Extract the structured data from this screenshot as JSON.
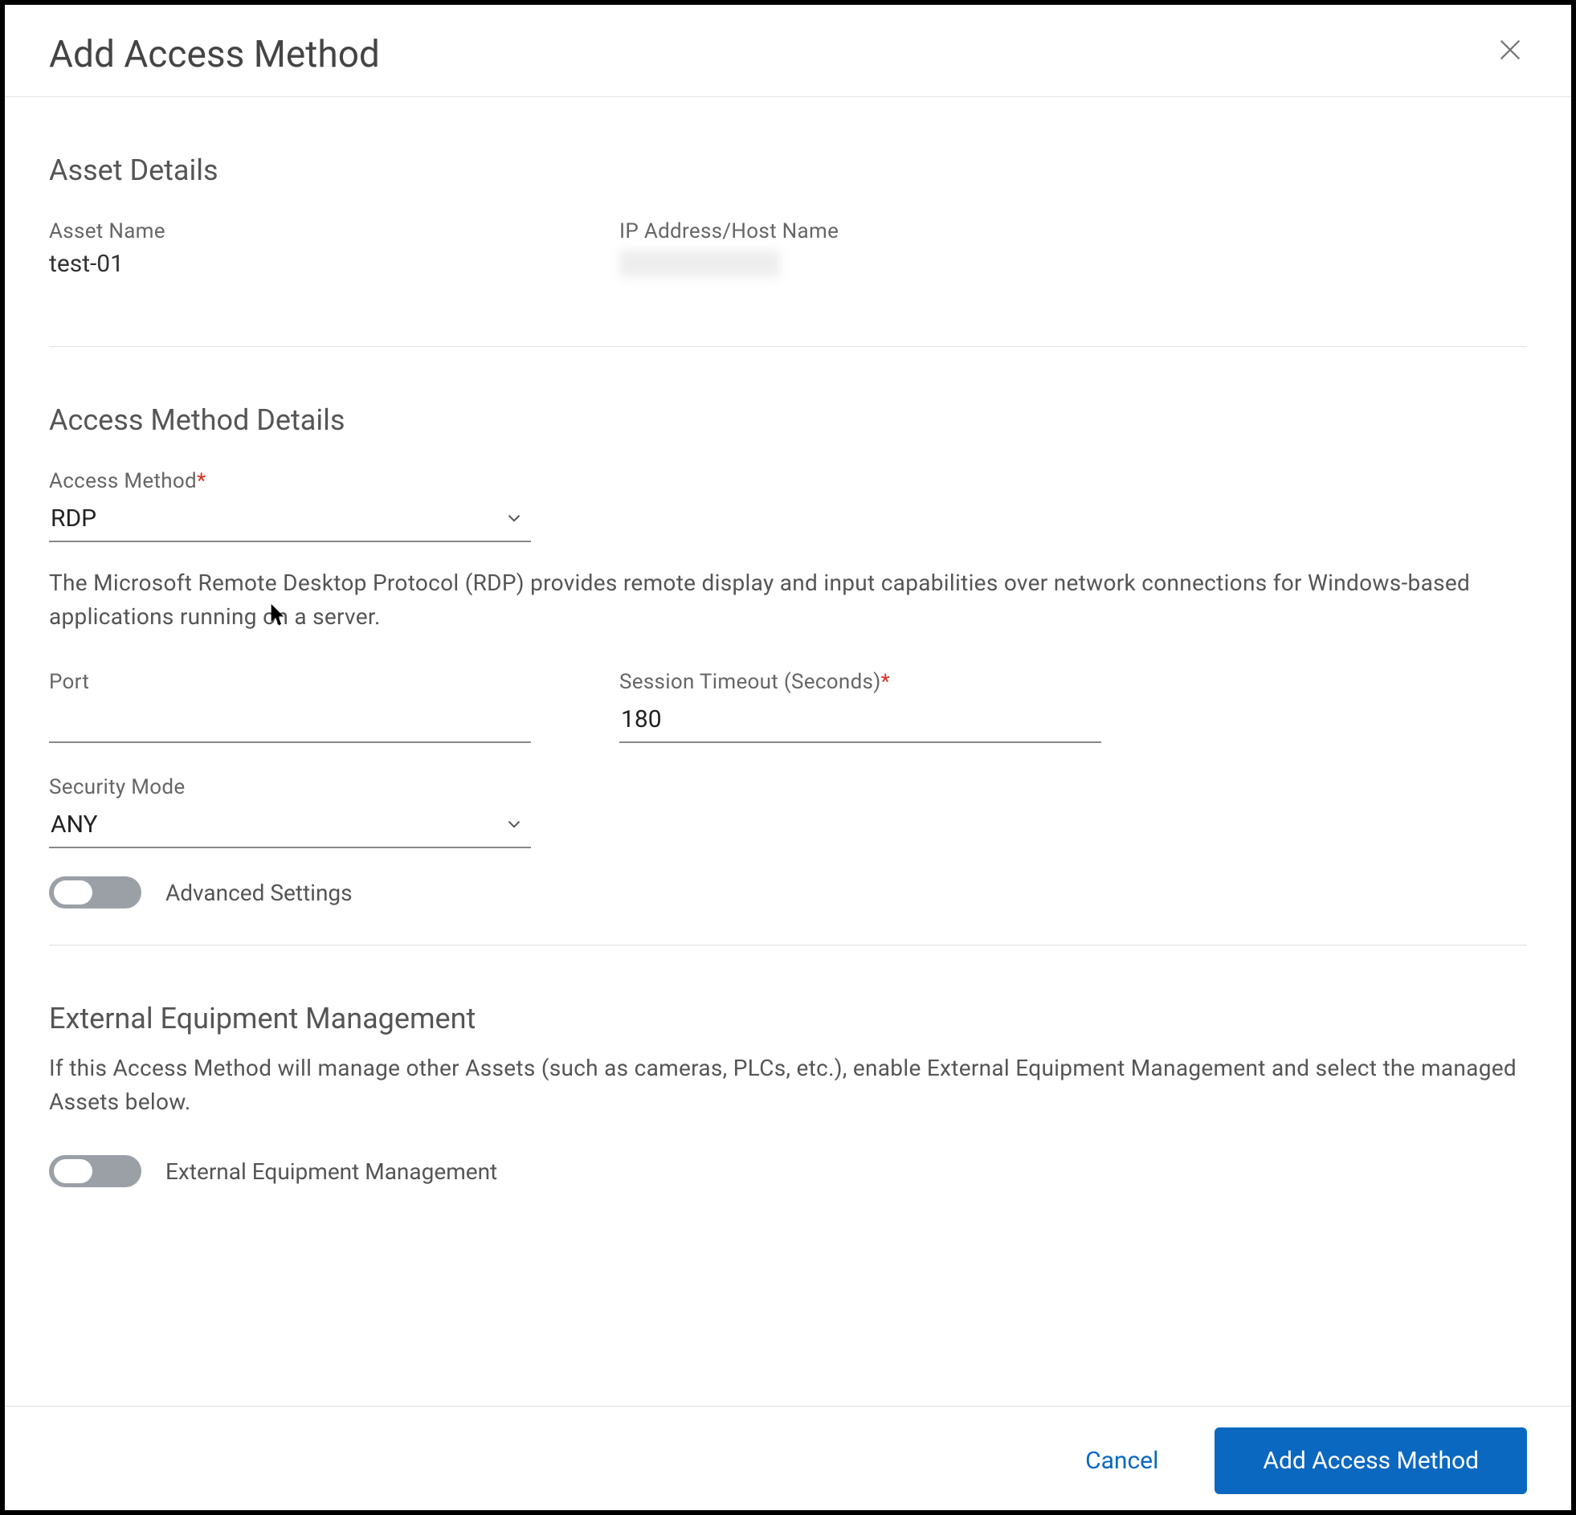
{
  "dialog": {
    "title": "Add Access Method"
  },
  "assetDetails": {
    "heading": "Asset Details",
    "assetNameLabel": "Asset Name",
    "assetNameValue": "test-01",
    "ipLabel": "IP Address/Host Name",
    "ipValue": ""
  },
  "accessMethodDetails": {
    "heading": "Access Method Details",
    "accessMethodLabel": "Access Method",
    "accessMethodValue": "RDP",
    "description": "The Microsoft Remote Desktop Protocol (RDP) provides remote display and input capabilities over network connections for Windows-based applications running on a server.",
    "portLabel": "Port",
    "portValue": "",
    "sessionTimeoutLabel": "Session Timeout (Seconds)",
    "sessionTimeoutValue": "180",
    "securityModeLabel": "Security Mode",
    "securityModeValue": "ANY",
    "advancedSettingsLabel": "Advanced Settings"
  },
  "externalEquipment": {
    "heading": "External Equipment Management",
    "description": "If this Access Method will manage other Assets (such as cameras, PLCs, etc.), enable External Equipment Management and select the managed Assets below.",
    "toggleLabel": "External Equipment Management"
  },
  "footer": {
    "cancel": "Cancel",
    "submit": "Add Access Method"
  }
}
